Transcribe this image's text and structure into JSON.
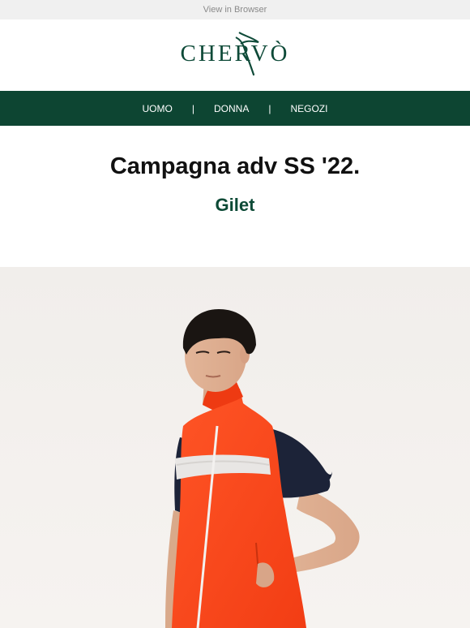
{
  "preheader": {
    "view_in_browser": "View in Browser"
  },
  "brand": {
    "name": "CHERVÒ",
    "color": "#0e4a38"
  },
  "nav": {
    "items": [
      {
        "label": "UOMO"
      },
      {
        "label": "DONNA"
      },
      {
        "label": "NEGOZI"
      }
    ],
    "separator": "|",
    "background": "#0d4532"
  },
  "headline": "Campagna adv SS '22.",
  "subheadline": "Gilet",
  "hero": {
    "product_color": "#ff4a1f"
  }
}
